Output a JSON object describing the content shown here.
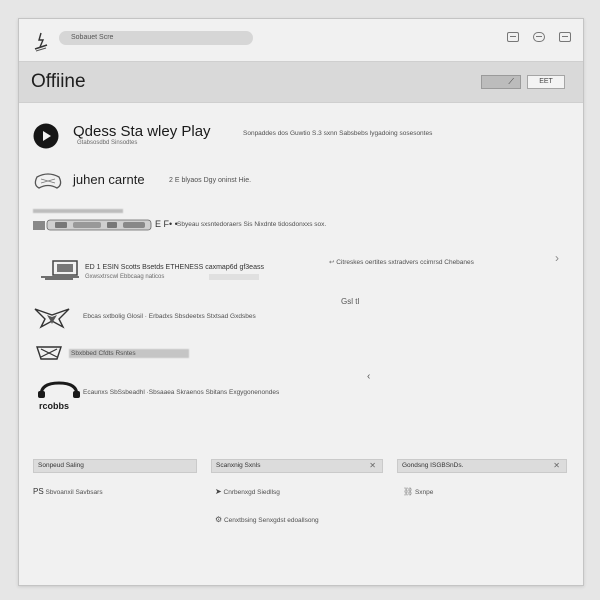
{
  "topbar": {
    "address_text": "Sobauet Scre",
    "icons": [
      "grid-icon",
      "card-icon",
      "window-icon"
    ]
  },
  "header": {
    "title": "Offiine",
    "button_a_label": "⟋",
    "button_b_label": "EET"
  },
  "items": [
    {
      "title": "Qdess Sta wley Play",
      "description": "Sonpaddes dos Guwtio S.3 sxnn Sabsbebs lygadoing sosesontes",
      "subline": "Gtabsosdbd Sinsodtes",
      "icon": "play-icon"
    },
    {
      "title": "juhen carnte",
      "description": "2 E blyaos Dgy oninst Hie.",
      "icon": "controller-icon"
    },
    {
      "title": "E F• •",
      "description": "Sbyeau sxsntedoraers Sis Nixdnte tidosdonxxs sox.",
      "icon": "gamepad-icon"
    },
    {
      "title": "ED 1 ESIN Scotts Bsetds ETHENESS caxmap6d gf3eass",
      "subline": "Gxwsxtrscwl Ebbcaag naticos",
      "side_note": "Citreskes oertites sxtradvers ccimrsd Chebanes",
      "icon": "monitor-icon"
    },
    {
      "title": "Ebcas sxtbolig Glosil · Erbadxs Sbsdeetxs Stxtsad Gxdsbes",
      "note": "Gsl tl",
      "icon": "star-emblem-icon"
    },
    {
      "title": "Sbxbbed Cfdts Rsntes",
      "icon": "xbox-logo-icon"
    },
    {
      "title": "Ecaunxs SbSsbeadhl ·Sbsaaea Skraenos Sbitans Exgygonenondes",
      "brand": "rcobbs",
      "icon": "headset-icon"
    }
  ],
  "panels": [
    {
      "title": "Sonpeud Saling",
      "rows": [
        {
          "icon": "ps-icon",
          "label": "Sbvoanxil Savbsars"
        }
      ]
    },
    {
      "title": "Scanxnig Sxnls",
      "rows": [
        {
          "icon": "arrow-icon",
          "label": "Cnrbenxgd Siedllsg"
        },
        {
          "icon": "gear-icon",
          "label": "Cenxtbsing Senxgdst edoallsong"
        }
      ]
    },
    {
      "title": "Gondsng ISGBSnDs.",
      "rows": [
        {
          "icon": "link-icon",
          "label": "Sxnpe"
        }
      ]
    }
  ]
}
